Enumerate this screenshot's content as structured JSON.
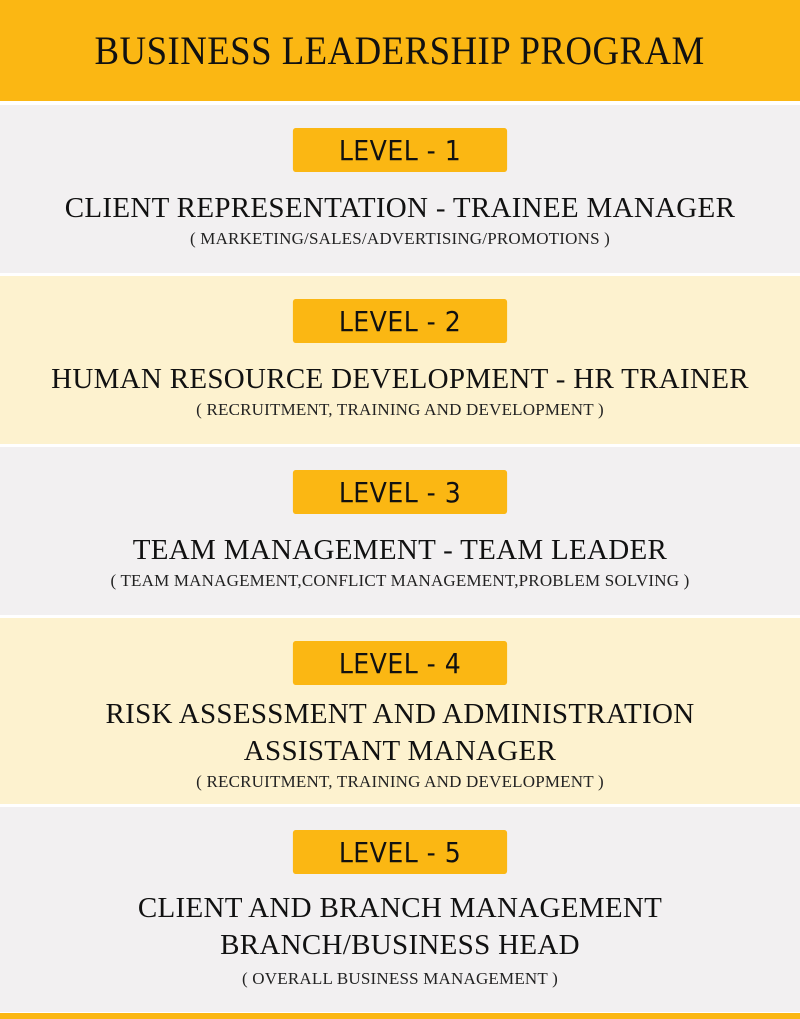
{
  "title": "BUSINESS LEADERSHIP PROGRAM",
  "levels": [
    {
      "badge": "LEVEL - 1",
      "role_lines": [
        "CLIENT REPRESENTATION - TRAINEE MANAGER"
      ],
      "detail": "( MARKETING/SALES/ADVERTISING/PROMOTIONS )"
    },
    {
      "badge": "LEVEL - 2",
      "role_lines": [
        "HUMAN RESOURCE DEVELOPMENT - HR TRAINER"
      ],
      "detail": "( RECRUITMENT, TRAINING AND DEVELOPMENT )"
    },
    {
      "badge": "LEVEL - 3",
      "role_lines": [
        "TEAM MANAGEMENT - TEAM LEADER"
      ],
      "detail": "( TEAM MANAGEMENT,CONFLICT MANAGEMENT,PROBLEM SOLVING )"
    },
    {
      "badge": "LEVEL - 4",
      "role_lines": [
        "RISK ASSESSMENT AND ADMINISTRATION",
        "ASSISTANT MANAGER"
      ],
      "detail": "( RECRUITMENT, TRAINING AND DEVELOPMENT )"
    },
    {
      "badge": "LEVEL - 5",
      "role_lines": [
        "CLIENT AND BRANCH MANAGEMENT",
        "BRANCH/BUSINESS HEAD"
      ],
      "detail": "( OVERALL BUSINESS MANAGEMENT )"
    }
  ],
  "colors": {
    "accent": "#fbb713",
    "section_gray": "#f2f0f1",
    "section_cream": "#fdf2cf"
  }
}
